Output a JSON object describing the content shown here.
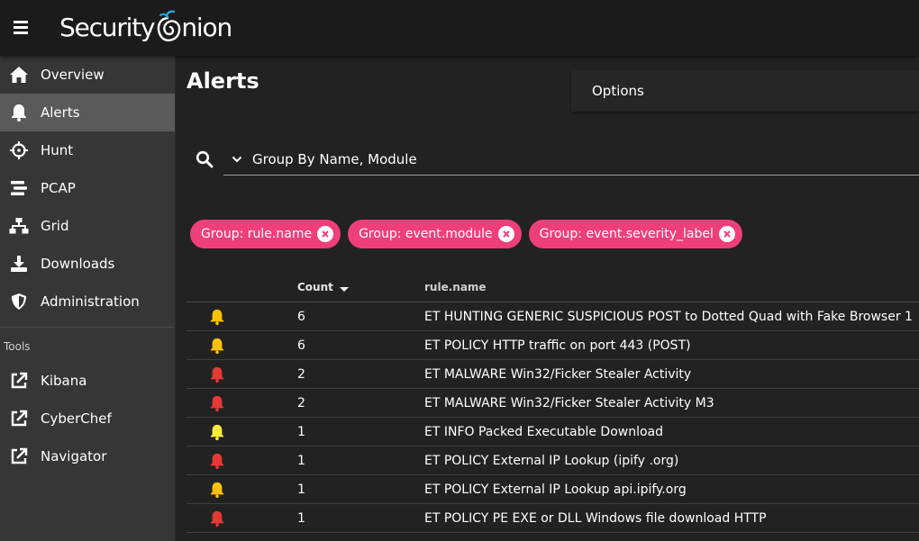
{
  "app": {
    "logo_text": "Security",
    "logo_text_tail": "nion"
  },
  "colors": {
    "topbar": "#1b1b1b",
    "sidebar": "#363636",
    "active": "#5a5a5a",
    "chip": "#ef3f7a",
    "severity_high": "#e53935",
    "severity_medium": "#ffc107"
  },
  "sidebar": {
    "items": [
      {
        "label": "Overview",
        "icon": "home-icon"
      },
      {
        "label": "Alerts",
        "icon": "bell-icon"
      },
      {
        "label": "Hunt",
        "icon": "crosshairs-icon"
      },
      {
        "label": "PCAP",
        "icon": "stream-icon"
      },
      {
        "label": "Grid",
        "icon": "network-icon"
      },
      {
        "label": "Downloads",
        "icon": "download-icon"
      },
      {
        "label": "Administration",
        "icon": "shield-icon"
      }
    ],
    "tools_heading": "Tools",
    "tools": [
      {
        "label": "Kibana",
        "icon": "external-link-icon"
      },
      {
        "label": "CyberChef",
        "icon": "external-link-icon"
      },
      {
        "label": "Navigator",
        "icon": "external-link-icon"
      }
    ]
  },
  "main": {
    "title": "Alerts",
    "options_label": "Options",
    "query_value": "Group By Name, Module",
    "chips": [
      {
        "label": "Group: rule.name"
      },
      {
        "label": "Group: event.module"
      },
      {
        "label": "Group: event.severity_label"
      }
    ],
    "table": {
      "columns": {
        "count": "Count",
        "rule": "rule.name"
      },
      "rows": [
        {
          "count": "6",
          "rule": "ET HUNTING GENERIC SUSPICIOUS POST to Dotted Quad with Fake Browser 1",
          "severity": "medium"
        },
        {
          "count": "6",
          "rule": "ET POLICY HTTP traffic on port 443 (POST)",
          "severity": "medium"
        },
        {
          "count": "2",
          "rule": "ET MALWARE Win32/Ficker Stealer Activity",
          "severity": "high"
        },
        {
          "count": "2",
          "rule": "ET MALWARE Win32/Ficker Stealer Activity M3",
          "severity": "high"
        },
        {
          "count": "1",
          "rule": "ET INFO Packed Executable Download",
          "severity": "low"
        },
        {
          "count": "1",
          "rule": "ET POLICY External IP Lookup (ipify .org)",
          "severity": "high"
        },
        {
          "count": "1",
          "rule": "ET POLICY External IP Lookup api.ipify.org",
          "severity": "medium"
        },
        {
          "count": "1",
          "rule": "ET POLICY PE EXE or DLL Windows file download HTTP",
          "severity": "high"
        }
      ]
    }
  }
}
